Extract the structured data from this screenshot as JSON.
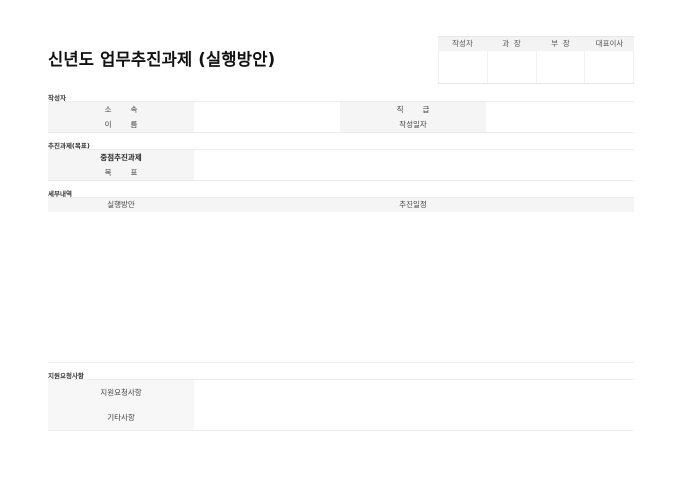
{
  "document": {
    "title": "신년도 업무추진과제 (실행방안)",
    "approval": {
      "headers": [
        "작성자",
        "과  장",
        "부  장",
        "대표이사"
      ]
    },
    "sections": {
      "author": {
        "heading": "작성자",
        "dept_label": "소        속",
        "position_label": "직        급",
        "name_label": "이        름",
        "date_label": "작성일자"
      },
      "task": {
        "heading": "추진과제(목표)",
        "key_task_label": "중점추진과제",
        "goal_label": "목        표"
      },
      "detail": {
        "heading": "세부내역",
        "plan_label": "실행방안",
        "schedule_label": "추진일정"
      },
      "support": {
        "heading": "지원요청사항",
        "request_label": "지원요청사항",
        "other_label": "기타사항"
      }
    }
  }
}
